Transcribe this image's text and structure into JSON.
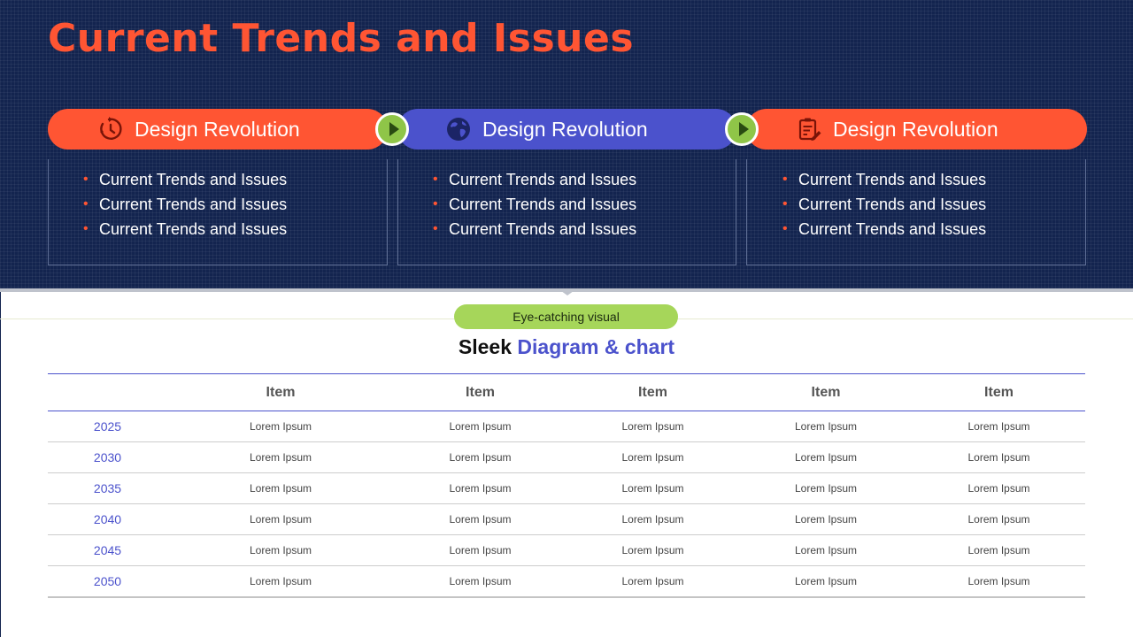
{
  "title": "Current Trends and Issues",
  "steps": [
    {
      "label": "Design Revolution",
      "icon": "timer-icon",
      "color": "#ff5533",
      "bullets": [
        "Current Trends and Issues",
        "Current Trends and Issues",
        "Current Trends and Issues"
      ]
    },
    {
      "label": "Design Revolution",
      "icon": "globe-icon",
      "color": "#4b52cc",
      "bullets": [
        "Current Trends and Issues",
        "Current Trends and Issues",
        "Current Trends and Issues"
      ]
    },
    {
      "label": "Design Revolution",
      "icon": "clipboard-edit-icon",
      "color": "#ff5533",
      "bullets": [
        "Current Trends and Issues",
        "Current Trends and Issues",
        "Current Trends and Issues"
      ]
    }
  ],
  "badge": "Eye-catching visual",
  "subtitle": {
    "plain": "Sleek",
    "accent": "Diagram & chart"
  },
  "table": {
    "headers": [
      "",
      "Item",
      "Item",
      "Item",
      "Item",
      "Item"
    ],
    "rows": [
      {
        "year": "2025",
        "cells": [
          "Lorem Ipsum",
          "Lorem Ipsum",
          "Lorem Ipsum",
          "Lorem Ipsum",
          "Lorem Ipsum"
        ]
      },
      {
        "year": "2030",
        "cells": [
          "Lorem Ipsum",
          "Lorem Ipsum",
          "Lorem Ipsum",
          "Lorem Ipsum",
          "Lorem Ipsum"
        ]
      },
      {
        "year": "2035",
        "cells": [
          "Lorem Ipsum",
          "Lorem Ipsum",
          "Lorem Ipsum",
          "Lorem Ipsum",
          "Lorem Ipsum"
        ]
      },
      {
        "year": "2040",
        "cells": [
          "Lorem Ipsum",
          "Lorem Ipsum",
          "Lorem Ipsum",
          "Lorem Ipsum",
          "Lorem Ipsum"
        ]
      },
      {
        "year": "2045",
        "cells": [
          "Lorem Ipsum",
          "Lorem Ipsum",
          "Lorem Ipsum",
          "Lorem Ipsum",
          "Lorem Ipsum"
        ]
      },
      {
        "year": "2050",
        "cells": [
          "Lorem Ipsum",
          "Lorem Ipsum",
          "Lorem Ipsum",
          "Lorem Ipsum",
          "Lorem Ipsum"
        ]
      }
    ]
  },
  "colors": {
    "navy": "#13244f",
    "orange": "#ff5533",
    "blue": "#4b52cc",
    "green": "#8fc548",
    "badge_green": "#a6d65a"
  }
}
